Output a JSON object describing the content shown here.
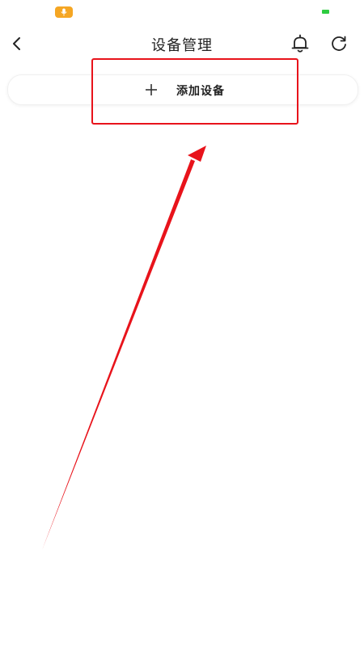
{
  "status_bar": {
    "mic_icon": "microphone-icon",
    "battery_icon": "battery-icon",
    "mic_color": "#f5a623",
    "battery_color": "#2ecc40"
  },
  "header": {
    "title": "设备管理",
    "back_icon": "chevron-left-icon",
    "bell_icon": "bell-icon",
    "refresh_icon": "refresh-icon"
  },
  "add_device": {
    "label": "添加设备",
    "icon": "plus-icon"
  },
  "annotation": {
    "color": "#e8131b"
  }
}
